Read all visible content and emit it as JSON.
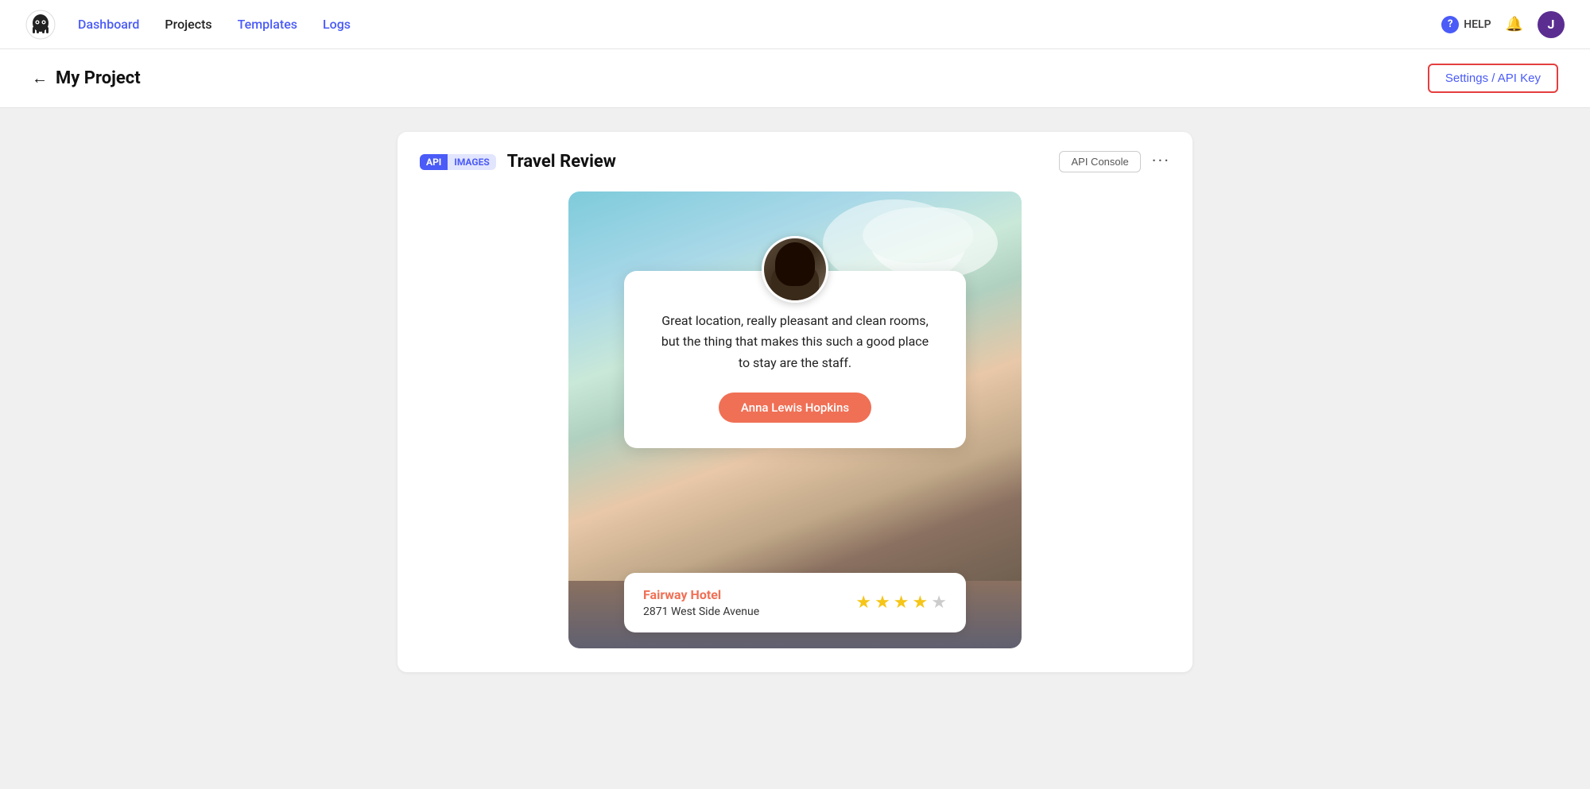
{
  "nav": {
    "logo_alt": "App Logo",
    "links": [
      {
        "label": "Dashboard",
        "active": true
      },
      {
        "label": "Projects",
        "active": false
      },
      {
        "label": "Templates",
        "active": true
      },
      {
        "label": "Logs",
        "active": true
      }
    ],
    "help_label": "HELP",
    "avatar_letter": "J"
  },
  "page_header": {
    "back_arrow": "←",
    "title": "My Project",
    "settings_button": "Settings / API Key"
  },
  "project_card": {
    "badge_api": "API",
    "badge_images": "IMAGES",
    "title": "Travel Review",
    "api_console_btn": "API Console",
    "more_menu": "···"
  },
  "review": {
    "text": "Great location, really pleasant and clean rooms, but the thing that makes this such a good place to stay are the staff.",
    "reviewer_name": "Anna Lewis Hopkins"
  },
  "hotel": {
    "name": "Fairway Hotel",
    "address": "2871 West Side Avenue",
    "stars": [
      true,
      true,
      true,
      true,
      false
    ]
  }
}
